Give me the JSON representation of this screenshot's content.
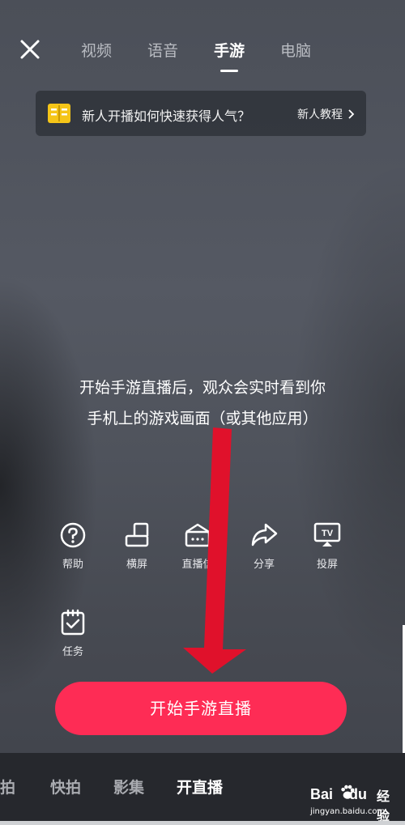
{
  "top": {
    "tabs": [
      {
        "label": "视频"
      },
      {
        "label": "语音"
      },
      {
        "label": "手游"
      },
      {
        "label": "电脑"
      }
    ],
    "active_tab": "手游"
  },
  "banner": {
    "text": "新人开播如何快速获得人气？",
    "link": "新人教程"
  },
  "description": {
    "line1": "开始手游直播后，观众会实时看到你",
    "line2": "手机上的游戏画面（或其他应用）"
  },
  "tools": [
    {
      "label": "帮助",
      "icon": "help-icon"
    },
    {
      "label": "横屏",
      "icon": "landscape-icon"
    },
    {
      "label": "直播信",
      "icon": "live-info-icon"
    },
    {
      "label": "分享",
      "icon": "share-icon"
    },
    {
      "label": "投屏",
      "icon": "cast-icon"
    },
    {
      "label": "任务",
      "icon": "task-icon"
    }
  ],
  "start_button": {
    "label": "开始手游直播"
  },
  "bottom_nav": [
    {
      "label": "拍"
    },
    {
      "label": "快拍"
    },
    {
      "label": "影集"
    },
    {
      "label": "开直播"
    }
  ],
  "watermark": {
    "brand": "Bai",
    "brand2": "du",
    "product": "经验",
    "url": "jingyan.baidu.com"
  },
  "colors": {
    "accent": "#fe2c55",
    "arrow": "#e0112b",
    "banner_icon": "#f5c518"
  }
}
